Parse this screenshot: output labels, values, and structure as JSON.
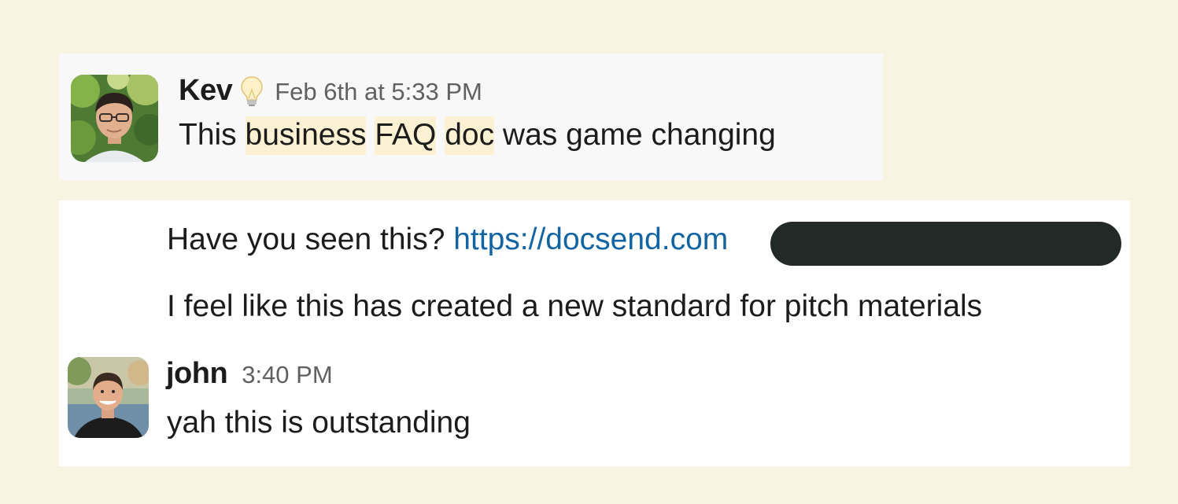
{
  "messages_top": {
    "author": "Kev",
    "status_emoji_icon": "lightbulb-icon",
    "timestamp": "Feb 6th at 5:33 PM",
    "text_parts": [
      "This",
      "business",
      "FAQ",
      "doc",
      "was game changing"
    ]
  },
  "messages_bottom": {
    "line1_prefix": "Have you seen this?",
    "line1_link": "https://docsend.com",
    "line2": "I feel like this has created a new standard for pitch materials",
    "reply": {
      "author": "john",
      "timestamp": "3:40 PM",
      "text": "yah this is outstanding"
    }
  },
  "colors": {
    "page_background": "#f7f5e1",
    "highlight": "#fdf1d3",
    "link": "#1264a3",
    "redaction": "#232927"
  }
}
